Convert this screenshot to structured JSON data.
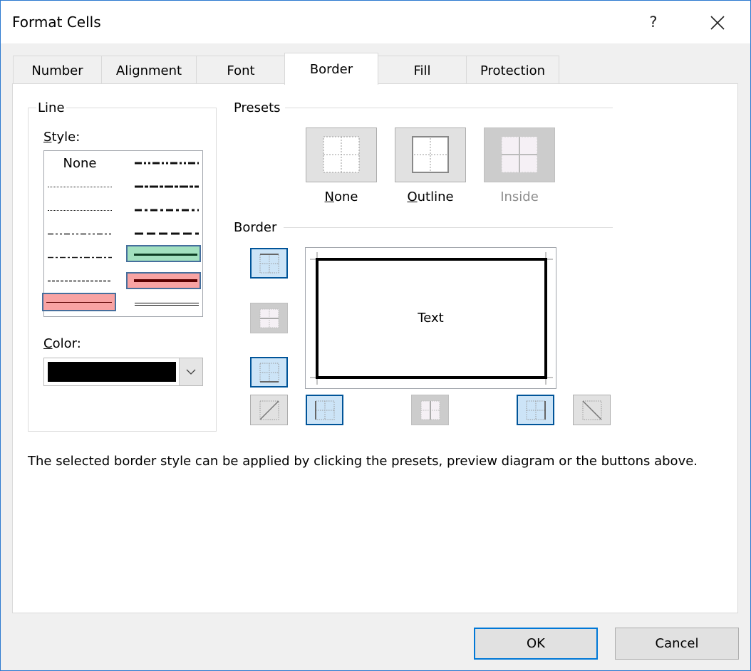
{
  "window": {
    "title": "Format Cells",
    "help_label": "?",
    "close_icon": "close-icon"
  },
  "tabs": [
    {
      "label": "Number",
      "active": false
    },
    {
      "label": "Alignment",
      "active": false
    },
    {
      "label": "Font",
      "active": false
    },
    {
      "label": "Border",
      "active": true
    },
    {
      "label": "Fill",
      "active": false
    },
    {
      "label": "Protection",
      "active": false
    }
  ],
  "line": {
    "group_label": "Line",
    "style_label_accel": "S",
    "style_label_rest": "tyle:",
    "style_none_label": "None",
    "styles_left": [
      "none",
      "hair-dotted",
      "dotted",
      "dash-dot-dot",
      "dash-dot",
      "dashed-thin",
      "thin-solid"
    ],
    "styles_right": [
      "medium-dash-dot-dot",
      "slanted-dash-dot",
      "medium-dash-dot",
      "medium-dashed",
      "medium-solid",
      "thick-solid",
      "double"
    ],
    "selected_style": "thin-solid",
    "highlighted_styles": {
      "medium-solid": "#a2e0bf",
      "thick-solid": "#f8a3a3",
      "thin-solid": "#f8a3a3"
    },
    "color_label_accel": "C",
    "color_label_rest": "olor:",
    "color_value": "#000000",
    "dropdown_icon": "chevron-down-icon"
  },
  "presets": {
    "section_label": "Presets",
    "items": [
      {
        "label_accel": "N",
        "label_rest": "one",
        "icon": "border-none-icon",
        "enabled": true
      },
      {
        "label_accel": "O",
        "label_rest": "utline",
        "icon": "border-outline-icon",
        "enabled": true
      },
      {
        "label_accel": "",
        "label_rest": "Inside",
        "icon": "border-inside-icon",
        "enabled": false
      }
    ]
  },
  "border": {
    "section_label": "Border",
    "preview_text": "Text",
    "buttons": [
      {
        "name": "top",
        "icon": "border-top-icon",
        "pressed": true,
        "enabled": true
      },
      {
        "name": "inside-horizontal",
        "icon": "border-inside-horizontal-icon",
        "pressed": false,
        "enabled": false
      },
      {
        "name": "bottom",
        "icon": "border-bottom-icon",
        "pressed": true,
        "enabled": true
      },
      {
        "name": "diagonal-up",
        "icon": "border-diagonal-up-icon",
        "pressed": false,
        "enabled": true
      },
      {
        "name": "left",
        "icon": "border-left-icon",
        "pressed": true,
        "enabled": true
      },
      {
        "name": "inside-vertical",
        "icon": "border-inside-vertical-icon",
        "pressed": false,
        "enabled": false
      },
      {
        "name": "right",
        "icon": "border-right-icon",
        "pressed": true,
        "enabled": true
      },
      {
        "name": "diagonal-down",
        "icon": "border-diagonal-down-icon",
        "pressed": false,
        "enabled": true
      }
    ]
  },
  "hint_text": "The selected border style can be applied by clicking the presets, preview diagram or the buttons above.",
  "footer": {
    "ok_label": "OK",
    "cancel_label": "Cancel"
  }
}
